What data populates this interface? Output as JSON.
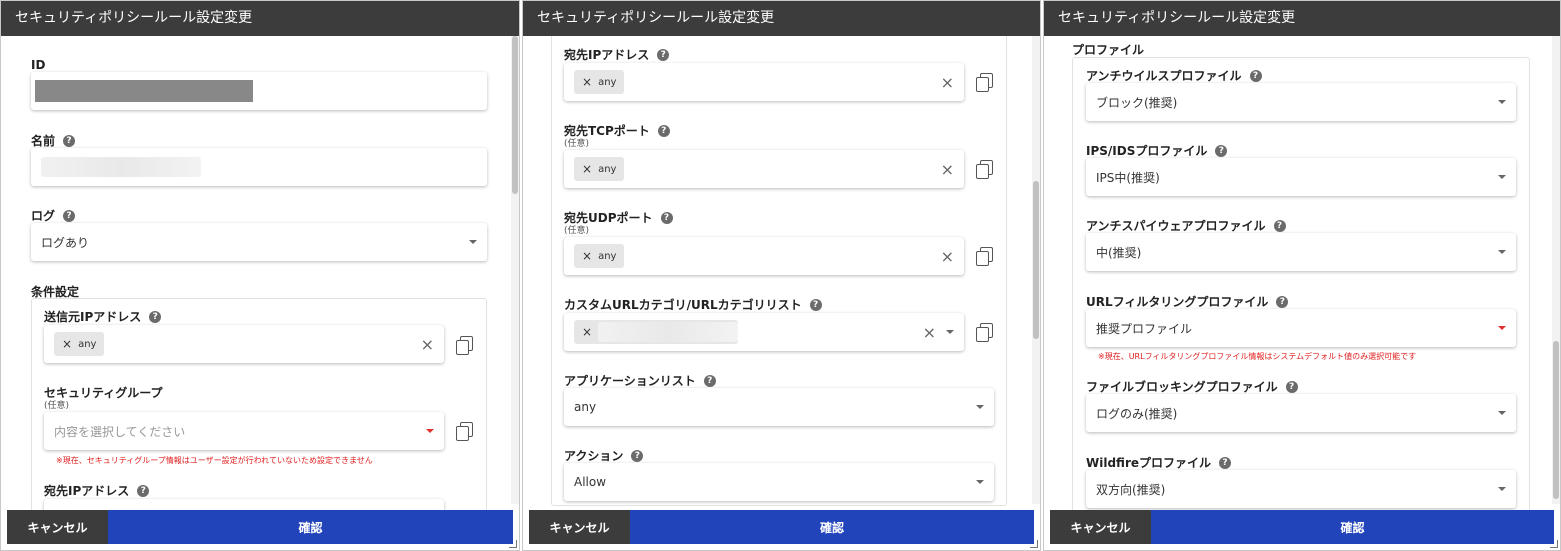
{
  "dialog_title": "セキュリティポリシールール設定変更",
  "footer": {
    "cancel_label": "キャンセル",
    "confirm_label": "確認"
  },
  "help_glyph": "?",
  "clear_glyph": "×",
  "optional_label": "(任意)",
  "panel1": {
    "id_label": "ID",
    "name_label": "名前",
    "log_label": "ログ",
    "log_value": "ログあり",
    "conditions_label": "条件設定",
    "source_ip_label": "送信元IPアドレス",
    "source_ip_chip": "any",
    "security_group_label": "セキュリティグループ",
    "security_group_placeholder": "内容を選択してください",
    "security_group_warning": "※現在、セキュリティグループ情報はユーザー設定が行われていないため設定できません",
    "dest_ip_label": "宛先IPアドレス"
  },
  "panel2": {
    "dest_ip_label": "宛先IPアドレス",
    "dest_ip_chip": "any",
    "tcp_label": "宛先TCPポート",
    "tcp_chip": "any",
    "udp_label": "宛先UDPポート",
    "udp_chip": "any",
    "url_category_label": "カスタムURLカテゴリ/URLカテゴリリスト",
    "app_list_label": "アプリケーションリスト",
    "app_list_value": "any",
    "action_label": "アクション",
    "action_value": "Allow"
  },
  "panel3": {
    "profiles_label": "プロファイル",
    "antivirus_label": "アンチウイルスプロファイル",
    "antivirus_value": "ブロック(推奨)",
    "ips_label": "IPS/IDSプロファイル",
    "ips_value": "IPS中(推奨)",
    "antispyware_label": "アンチスパイウェアプロファイル",
    "antispyware_value": "中(推奨)",
    "url_filter_label": "URLフィルタリングプロファイル",
    "url_filter_value": "推奨プロファイル",
    "url_filter_warning": "※現在、URLフィルタリングプロファイル情報はシステムデフォルト値のみ選択可能です",
    "file_blocking_label": "ファイルブロッキングプロファイル",
    "file_blocking_value": "ログのみ(推奨)",
    "wildfire_label": "Wildfireプロファイル",
    "wildfire_value": "双方向(推奨)"
  }
}
